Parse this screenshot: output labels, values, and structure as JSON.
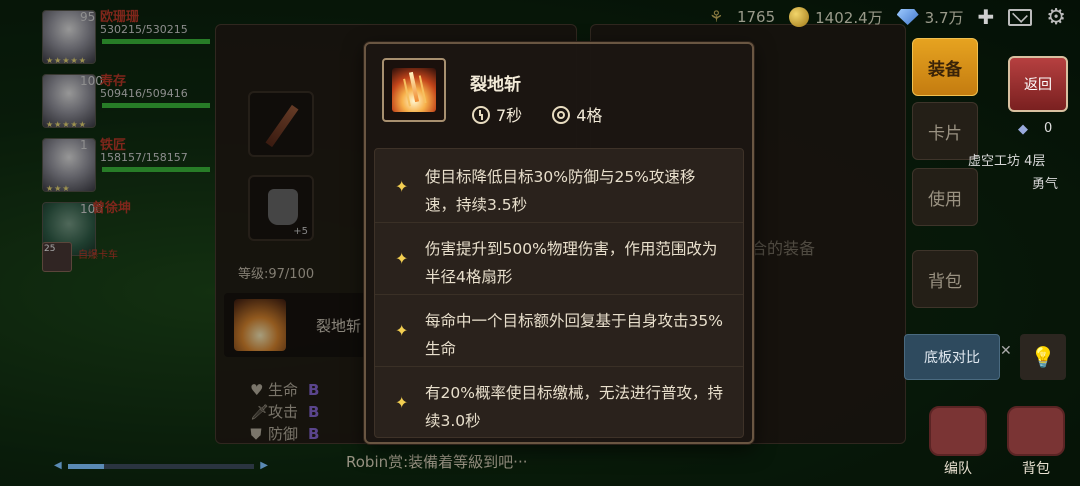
{
  "topbar": {
    "wheat_value": "1765",
    "gold_value": "1402.4万",
    "gem_value": "3.7万"
  },
  "party": [
    {
      "level": "95",
      "name": "欧珊珊",
      "hp": "530215/530215",
      "hp_fill": 1.0
    },
    {
      "level": "100",
      "name": "寿存",
      "hp": "509416/509416",
      "hp_fill": 1.0
    },
    {
      "level": "1",
      "name": "铁匠",
      "hp": "158157/158157",
      "hp_fill": 1.0
    }
  ],
  "extra_member": {
    "level": "100",
    "name": "曾徐坤"
  },
  "small_member": {
    "level": "25",
    "name": "自爆卡车"
  },
  "equip_panel": {
    "level_text": "等级:97/100",
    "armor_plus": "+5",
    "skill_name": "裂地斩",
    "stats": [
      {
        "icon": "heart-icon",
        "glyph": "♥",
        "label": "生命",
        "grade": "B"
      },
      {
        "icon": "sword-icon",
        "glyph": "🗡",
        "label": "攻击",
        "grade": "B"
      },
      {
        "icon": "shield-icon",
        "glyph": "⛊",
        "label": "防御",
        "grade": "B"
      }
    ],
    "bottom_message": "Robin赏:装備着等級到吧···"
  },
  "right_panel": {
    "hint_text": "合的装备"
  },
  "sidebar": {
    "tabs": [
      "装备",
      "卡片",
      "使用",
      "背包"
    ],
    "back_label": "返回",
    "crystal_value": "0",
    "dungeon": "虚空工坊 4层",
    "courage": "勇气",
    "compare_label": "底板对比",
    "bottom_buttons": [
      "编队",
      "背包"
    ]
  },
  "tooltip": {
    "skill_name": "裂地斩",
    "cooldown": "7秒",
    "range": "4格",
    "effects": [
      "使目标降低目标30%防御与25%攻速移速，持续3.5秒",
      "伤害提升到500%物理伤害，作用范围改为半径4格扇形",
      "每命中一个目标额外回复基于自身攻击35%生命",
      "有20%概率使目标缴械，无法进行普攻，持续3.0秒"
    ]
  },
  "colors": {
    "accent_tab": "#e6a320",
    "star": "#f3cf52",
    "enemy_name": "#c23b2a",
    "grade_b": "#8a6ad8"
  }
}
